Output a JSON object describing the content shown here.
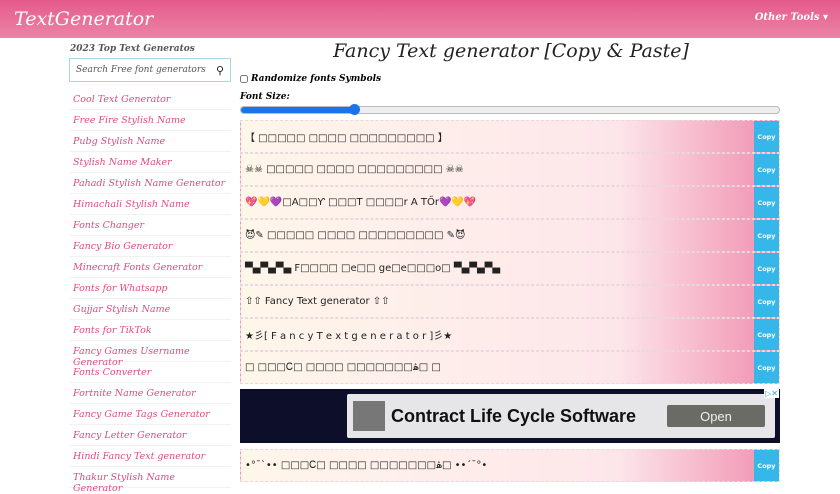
{
  "header": {
    "logo": "TextGenerator",
    "other_tools": "Other Tools ▾"
  },
  "sidebar": {
    "heading": "2023 Top Text Generatos",
    "search_placeholder": "Search Free font generators",
    "items": [
      "Cool Text Generator",
      "Free Fire Stylish Name",
      "Pubg Stylish Name",
      "Stylish Name Maker",
      "Pahadi Stylish Name Generator",
      "Himachali Stylish Name",
      "Fonts Changer",
      "Fancy Bio Generator",
      "Minecraft Fonts Generator",
      "Fonts for Whatsapp",
      "Gujjar Stylish Name",
      "Fonts for TikTok",
      "Fancy Games Username Generator",
      "Fonts Converter",
      "Fortnite Name Generator",
      "Fancy Game Tags Generator",
      "Fancy Letter Generator",
      "Hindi Fancy Text generator",
      "Thakur Stylish Name Generator"
    ]
  },
  "main": {
    "title": "Fancy Text generator [Copy & Paste]",
    "randomize_label": "Randomize fonts Symbols",
    "font_size_label": "Font Size:",
    "font_size_fraction": 0.21,
    "copy_label": "Copy",
    "rows": [
      "【 □□□□□ □□□□ □□□□□□□□□ 】",
      "☠☠ □□□□□ □□□□ □□□□□□□□□ ☠☠",
      "💖💛💜□A□□Ƴ □□□T □□□□r A TŐr💜💛💖",
      "😈✎ □□□□□ □□□□ □□□□□□□□□ ✎😈",
      "▀▄▀▄▀▄ F□□□□ □e□□ ge□e□□□o□ ▀▄▀▄▀▄",
      "⇧⇧ Fancy Text generator ⇧⇧",
      "★彡[ F a n c y  T e x t  g e n e r a t o r ]彡★",
      "□ □□□Ꮯ□ □□□□ □□□□□□□ۿ□ □"
    ],
    "row_after_ad": "•°¯`•• □□□Ꮯ□ □□□□ □□□□□□□ۿ□ ••´¯°•"
  },
  "ad": {
    "headline": "Contract Life Cycle Software",
    "button": "Open",
    "badge": "▷✕"
  }
}
